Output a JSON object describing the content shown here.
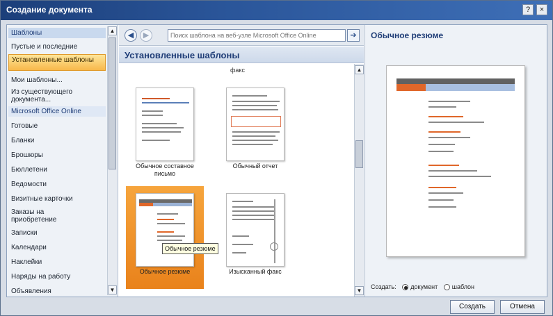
{
  "window": {
    "title": "Создание документа",
    "help_label": "?",
    "close_label": "×"
  },
  "sidebar": {
    "items": [
      {
        "label": "Шаблоны",
        "kind": "header"
      },
      {
        "label": "Пустые и последние",
        "kind": "normal"
      },
      {
        "label": "Установленные шаблоны",
        "kind": "selected"
      },
      {
        "label": "Мои шаблоны...",
        "kind": "normal"
      },
      {
        "label": "Из существующего документа...",
        "kind": "normal"
      },
      {
        "label": "Microsoft Office Online",
        "kind": "online"
      },
      {
        "label": "Готовые",
        "kind": "normal"
      },
      {
        "label": "Бланки",
        "kind": "normal"
      },
      {
        "label": "Брошюры",
        "kind": "normal"
      },
      {
        "label": "Бюллетени",
        "kind": "normal"
      },
      {
        "label": "Ведомости",
        "kind": "normal"
      },
      {
        "label": "Визитные карточки",
        "kind": "normal"
      },
      {
        "label": "Заказы на приобретение",
        "kind": "normal"
      },
      {
        "label": "Записки",
        "kind": "normal"
      },
      {
        "label": "Календари",
        "kind": "normal"
      },
      {
        "label": "Наклейки",
        "kind": "normal"
      },
      {
        "label": "Наряды на работу",
        "kind": "normal"
      },
      {
        "label": "Объявления",
        "kind": "normal"
      }
    ]
  },
  "nav": {
    "back_icon": "back-arrow-icon",
    "forward_icon": "forward-arrow-icon",
    "search_placeholder": "Поиск шаблона на веб-узле Microsoft Office Online",
    "search_value": ""
  },
  "gallery": {
    "section_title": "Установленные шаблоны",
    "partial_caption": "факс",
    "tiles": [
      {
        "label": "Обычное составное письмо",
        "selected": false
      },
      {
        "label": "Обычный отчет",
        "selected": false
      },
      {
        "label": "Обычное резюме",
        "selected": true
      },
      {
        "label": "Изысканный факс",
        "selected": false
      }
    ],
    "tooltip": "Обычное резюме"
  },
  "preview": {
    "title": "Обычное резюме",
    "create_label": "Создать:",
    "option_document": "документ",
    "option_template": "шаблон",
    "selected_option": "document"
  },
  "buttons": {
    "create": "Создать",
    "cancel": "Отмена"
  },
  "colors": {
    "accent_orange": "#e9821b",
    "header_blue": "#1f3d77",
    "title_bar": "#1c3f7a"
  }
}
